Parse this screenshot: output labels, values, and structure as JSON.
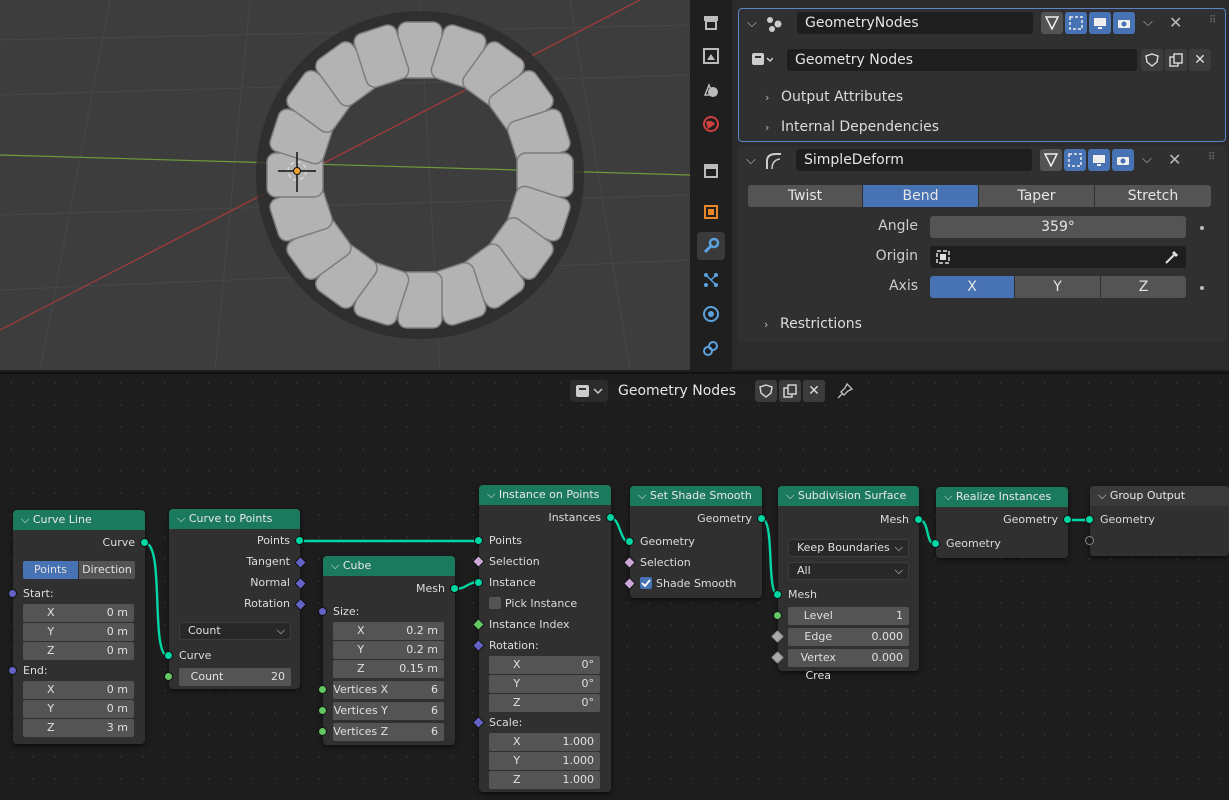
{
  "modifiers": [
    {
      "name": "GeometryNodes",
      "group": "Geometry Nodes",
      "rows": [
        "Output Attributes",
        "Internal Dependencies"
      ]
    },
    {
      "name": "SimpleDeform",
      "modes": [
        "Twist",
        "Bend",
        "Taper",
        "Stretch"
      ],
      "active_mode": "Bend",
      "angle_label": "Angle",
      "angle": "359°",
      "origin_label": "Origin",
      "axis_label": "Axis",
      "axes": [
        "X",
        "Y",
        "Z"
      ],
      "active_axis": "X",
      "restrictions": "Restrictions"
    }
  ],
  "node_editor": {
    "group_name": "Geometry Nodes"
  },
  "nodes": {
    "curve_line": {
      "title": "Curve Line",
      "out": "Curve",
      "modes": [
        "Points",
        "Direction"
      ],
      "start": "Start:",
      "end": "End:",
      "start_vals": [
        [
          "X",
          "0 m"
        ],
        [
          "Y",
          "0 m"
        ],
        [
          "Z",
          "0 m"
        ]
      ],
      "end_vals": [
        [
          "X",
          "0 m"
        ],
        [
          "Y",
          "0 m"
        ],
        [
          "Z",
          "3 m"
        ]
      ]
    },
    "curve_to_points": {
      "title": "Curve to Points",
      "outs": [
        "Points",
        "Tangent",
        "Normal",
        "Rotation"
      ],
      "mode": "Count",
      "in": "Curve",
      "count_label": "Count",
      "count": "20"
    },
    "cube": {
      "title": "Cube",
      "out": "Mesh",
      "size": "Size:",
      "size_vals": [
        [
          "X",
          "0.2 m"
        ],
        [
          "Y",
          "0.2 m"
        ],
        [
          "Z",
          "0.15 m"
        ]
      ],
      "verts": [
        [
          "Vertices X",
          "6"
        ],
        [
          "Vertices Y",
          "6"
        ],
        [
          "Vertices Z",
          "6"
        ]
      ]
    },
    "instance_on_points": {
      "title": "Instance on Points",
      "out": "Instances",
      "ins": [
        "Points",
        "Selection",
        "Instance"
      ],
      "pick": "Pick Instance",
      "index": "Instance Index",
      "rotation": "Rotation:",
      "rot_vals": [
        [
          "X",
          "0°"
        ],
        [
          "Y",
          "0°"
        ],
        [
          "Z",
          "0°"
        ]
      ],
      "scale": "Scale:",
      "scale_vals": [
        [
          "X",
          "1.000"
        ],
        [
          "Y",
          "1.000"
        ],
        [
          "Z",
          "1.000"
        ]
      ]
    },
    "set_shade_smooth": {
      "title": "Set Shade Smooth",
      "out": "Geometry",
      "ins": [
        "Geometry",
        "Selection"
      ],
      "check": "Shade Smooth"
    },
    "subdivision": {
      "title": "Subdivision Surface",
      "out": "Mesh",
      "dd1": "Keep Boundaries",
      "dd2": "All",
      "in": "Mesh",
      "fields": [
        [
          "Level",
          "1"
        ],
        [
          "Edge Creas",
          "0.000"
        ],
        [
          "Vertex Crea",
          "0.000"
        ]
      ]
    },
    "realize": {
      "title": "Realize Instances",
      "out": "Geometry",
      "in": "Geometry"
    },
    "group_output": {
      "title": "Group Output",
      "in": "Geometry"
    }
  }
}
